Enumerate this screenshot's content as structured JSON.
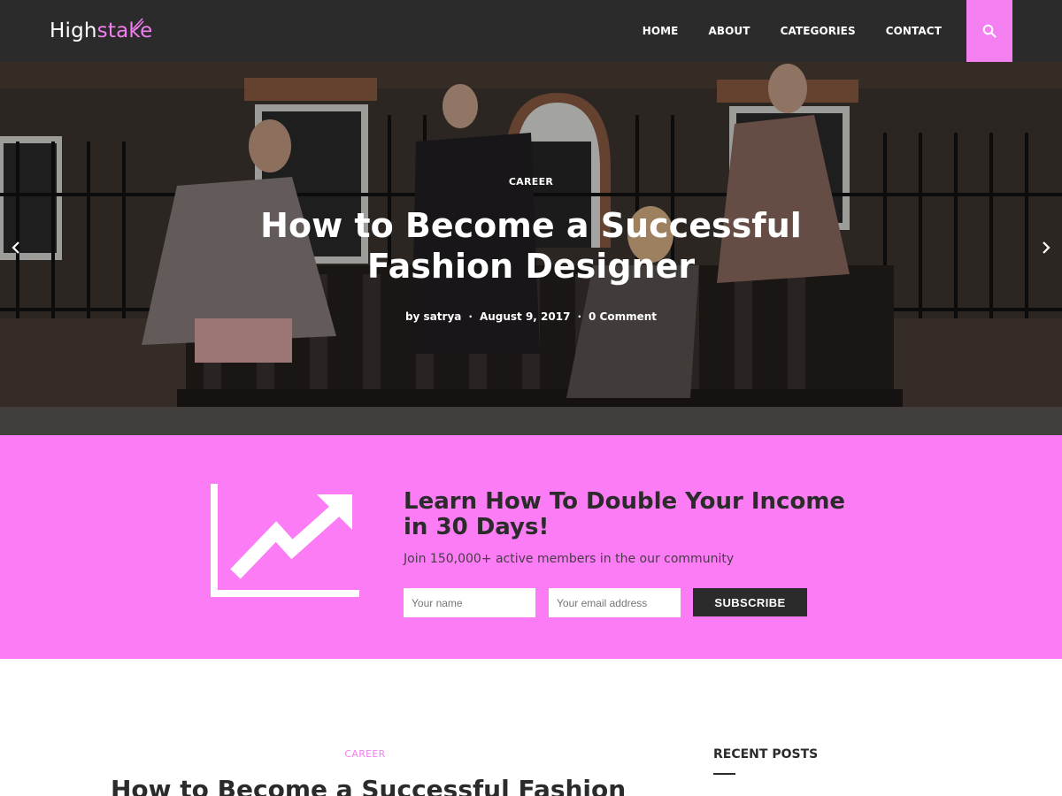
{
  "brand": {
    "name_part1": "High",
    "name_part2": "stake",
    "accent_color": "#f47ff0"
  },
  "nav": {
    "items": [
      {
        "label": "HOME"
      },
      {
        "label": "ABOUT"
      },
      {
        "label": "CATEGORIES"
      },
      {
        "label": "CONTACT"
      }
    ],
    "search_icon": "search-icon"
  },
  "hero": {
    "category": "CAREER",
    "title": "How to Become a Successful Fashion Designer",
    "author": "by satrya",
    "date": "August 9, 2017",
    "comments": "0 Comment",
    "prev_icon": "chevron-left-icon",
    "next_icon": "chevron-right-icon"
  },
  "subscribe": {
    "background": "#fb7cf4",
    "title": "Learn How To Double Your Income in 30 Days!",
    "subtitle": "Join 150,000+ active members in the our community",
    "name_placeholder": "Your name",
    "email_placeholder": "Your email address",
    "button_label": "SUBSCRIBE",
    "icon": "growth-chart-icon"
  },
  "post": {
    "category": "CAREER",
    "title": "How to Become a Successful Fashion"
  },
  "sidebar": {
    "title": "RECENT POSTS"
  }
}
